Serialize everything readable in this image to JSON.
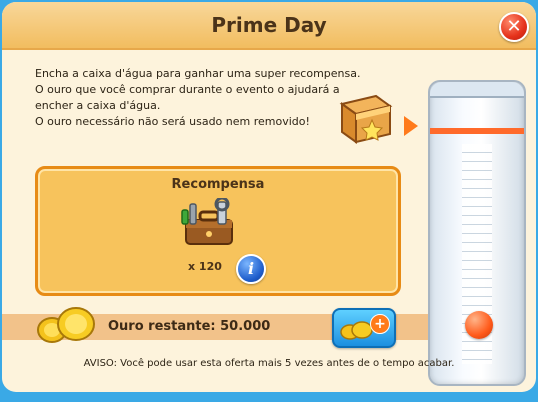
{
  "dialog": {
    "title": "Prime Day",
    "description": [
      "Encha a caixa d'água para ganhar uma super recompensa.",
      "O ouro que você comprar durante o evento o ajudará a",
      "encher a caixa d'água.",
      "O ouro necessário não será usado nem removido!"
    ],
    "reward": {
      "title": "Recompensa",
      "quantity": "x 120"
    },
    "gold_remaining": "Ouro restante: 50.000",
    "notice": "AVISO: Você pode usar esta oferta mais 5 vezes antes de o tempo acabar.",
    "icons": {
      "close": "close-icon",
      "chest": "treasure-chest-icon",
      "toolbox": "toolbox-icon",
      "info": "info-icon",
      "coins": "gold-coins-icon",
      "buy": "buy-gold-plus-icon"
    },
    "colors": {
      "header": "#f2bd5f",
      "accent": "#ff7a1b",
      "reward_border": "#e78b16",
      "close": "#e5321b",
      "info": "#1f5ecc"
    }
  }
}
